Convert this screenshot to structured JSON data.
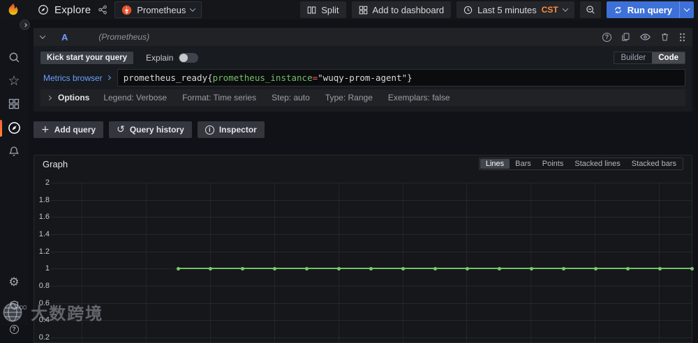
{
  "topbar": {
    "title": "Explore",
    "datasource": {
      "label": "Prometheus"
    },
    "split_label": "Split",
    "add_to_dashboard_label": "Add to dashboard",
    "time_range": {
      "label": "Last 5 minutes",
      "timezone": "CST"
    },
    "run_query_label": "Run query"
  },
  "query_editor": {
    "ref_id": "A",
    "datasource_hint": "(Prometheus)",
    "kick_start_label": "Kick start your query",
    "explain_label": "Explain",
    "explain_on": false,
    "builder_label": "Builder",
    "code_label": "Code",
    "editor_mode": "Code",
    "metrics_browser_label": "Metrics browser",
    "query_text": "prometheus_ready{prometheus_instance=\"wuqy-prom-agent\"}",
    "query_parts": [
      {
        "text": "prometheus_ready{",
        "color": "#d8d9da"
      },
      {
        "text": "prometheus_instance",
        "color": "#73bf69"
      },
      {
        "text": "=",
        "color": "#ff5e5e"
      },
      {
        "text": "\"wuqy-prom-agent\"",
        "color": "#d8d9da"
      },
      {
        "text": "}",
        "color": "#d8d9da"
      }
    ],
    "options_label": "Options",
    "options_items": [
      "Legend: Verbose",
      "Format: Time series",
      "Step: auto",
      "Type: Range",
      "Exemplars: false"
    ]
  },
  "actions": {
    "add_query": "Add query",
    "query_history": "Query history",
    "inspector": "Inspector"
  },
  "graph_panel": {
    "title": "Graph",
    "modes": [
      "Lines",
      "Bars",
      "Points",
      "Stacked lines",
      "Stacked bars"
    ],
    "active_mode": "Lines"
  },
  "chart_data": {
    "type": "line",
    "title": "Graph",
    "y_ticks": [
      "2",
      "1.8",
      "1.6",
      "1.4",
      "1.2",
      "1",
      "0.8",
      "0.6",
      "0.4",
      "0.2"
    ],
    "ylim_visible": [
      0.2,
      2
    ],
    "x_axis": {
      "range_label": "Last 5 minutes",
      "tick_labels_visible": false
    },
    "grid": true,
    "vertical_gridlines": 10,
    "series": [
      {
        "name": "prometheus_ready{prometheus_instance=\"wuqy-prom-agent\"}",
        "constant_value": 1,
        "num_points": 17,
        "color": "#73bf69",
        "point_color": "#7ec575"
      }
    ]
  },
  "icons": {
    "gear": "⚙",
    "star": "☆",
    "history": "↺",
    "plus": "+",
    "help": "?",
    "info": "i"
  },
  "watermark": {
    "text": "大数跨境",
    "suffix": "∞"
  },
  "colors": {
    "accent_blue": "#3d71d9",
    "link_blue": "#6e9fff",
    "series_green": "#73bf69",
    "timezone_orange": "#ff8c3a",
    "background": "#111217"
  }
}
